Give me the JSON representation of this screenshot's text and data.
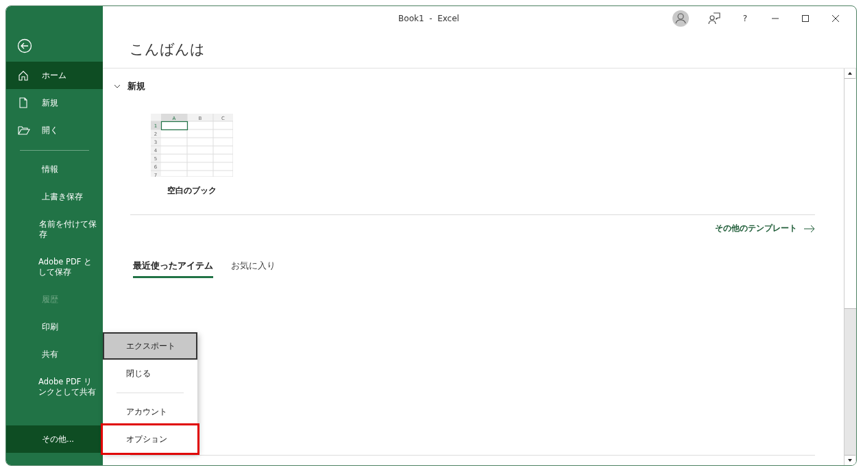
{
  "window": {
    "title": "Book1  -  Excel",
    "help_label": "?"
  },
  "sidebar": {
    "items": [
      {
        "kind": "back"
      },
      {
        "kind": "nav",
        "label": "ホーム",
        "selected": true,
        "disabled": false
      },
      {
        "kind": "nav",
        "label": "新規",
        "selected": false,
        "disabled": false
      },
      {
        "kind": "nav",
        "label": "開く",
        "selected": false,
        "disabled": false
      },
      {
        "kind": "divider"
      },
      {
        "kind": "nav",
        "label": "情報",
        "selected": false,
        "disabled": false
      },
      {
        "kind": "nav",
        "label": "上書き保存",
        "selected": false,
        "disabled": false
      },
      {
        "kind": "nav",
        "label": "名前を付けて保存",
        "selected": false,
        "disabled": false
      },
      {
        "kind": "nav",
        "label": "Adobe PDF として保存",
        "selected": false,
        "disabled": false
      },
      {
        "kind": "nav",
        "label": "履歴",
        "selected": false,
        "disabled": true
      },
      {
        "kind": "nav",
        "label": "印刷",
        "selected": false,
        "disabled": false
      },
      {
        "kind": "nav",
        "label": "共有",
        "selected": false,
        "disabled": false
      },
      {
        "kind": "nav",
        "label": "Adobe PDF リンクとして共有",
        "selected": false,
        "disabled": false
      },
      {
        "kind": "more",
        "label": "その他...",
        "selected": true,
        "disabled": false
      }
    ]
  },
  "main": {
    "greeting": "こんばんは",
    "new_section": {
      "title": "新規",
      "expanded": true,
      "templates": [
        {
          "label": "空白のブック",
          "columns": [
            "A",
            "B",
            "C"
          ],
          "rows": [
            "1",
            "2",
            "3",
            "4",
            "5",
            "6",
            "7"
          ]
        }
      ],
      "more_link": "その他のテンプレート"
    },
    "tabs": [
      {
        "label": "最近使ったアイテム",
        "selected": true
      },
      {
        "label": "お気に入り",
        "selected": false
      }
    ]
  },
  "popup_menu": {
    "items": [
      {
        "kind": "item",
        "label": "エクスポート",
        "selected": true,
        "annotated": false
      },
      {
        "kind": "item",
        "label": "閉じる",
        "selected": false,
        "annotated": false
      },
      {
        "kind": "divider"
      },
      {
        "kind": "item",
        "label": "アカウント",
        "selected": false,
        "annotated": false
      },
      {
        "kind": "item",
        "label": "オプション",
        "selected": false,
        "annotated": true
      }
    ]
  }
}
